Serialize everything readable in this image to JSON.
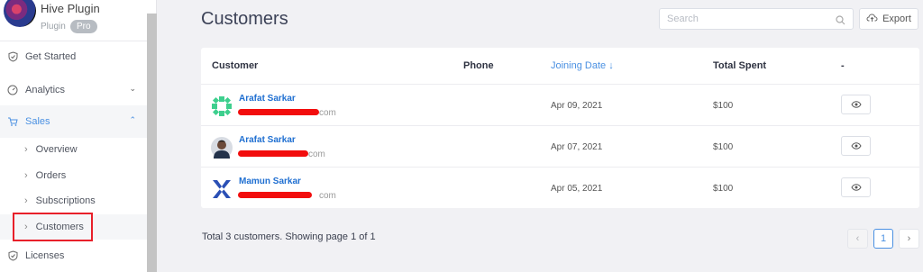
{
  "app": {
    "name": "Hive Plugin",
    "subtitle": "Plugin",
    "badge": "Pro"
  },
  "sidebar": {
    "items": [
      {
        "label": "Get Started",
        "icon": "shield-icon"
      },
      {
        "label": "Analytics",
        "icon": "gauge-icon"
      },
      {
        "label": "Sales",
        "icon": "cart-icon"
      },
      {
        "label": "Licenses",
        "icon": "shield-icon"
      }
    ],
    "sales_sub": [
      {
        "label": "Overview"
      },
      {
        "label": "Orders"
      },
      {
        "label": "Subscriptions"
      },
      {
        "label": "Customers"
      }
    ]
  },
  "page": {
    "title": "Customers",
    "search_placeholder": "Search",
    "export_label": "Export"
  },
  "table": {
    "headers": [
      "Customer",
      "Phone",
      "Joining Date",
      "Total Spent",
      "-"
    ],
    "sort_indicator": "↓",
    "rows": [
      {
        "name": "Arafat Sarkar",
        "email_tail": "com",
        "date": "Apr 09, 2021",
        "spent": "$100",
        "avatar": "green-pattern"
      },
      {
        "name": "Arafat Sarkar",
        "email_tail": "com",
        "date": "Apr 07, 2021",
        "spent": "$100",
        "avatar": "photo"
      },
      {
        "name": "Mamun Sarkar",
        "email_tail": "com",
        "date": "Apr 05, 2021",
        "spent": "$100",
        "avatar": "blue-pattern"
      }
    ]
  },
  "pagination": {
    "summary": "Total 3 customers. Showing page 1 of 1",
    "prev": "‹",
    "current": "1",
    "next": "›"
  },
  "colors": {
    "accent": "#4a90e2",
    "link": "#1f6fd1",
    "highlight": "#e8202a"
  }
}
